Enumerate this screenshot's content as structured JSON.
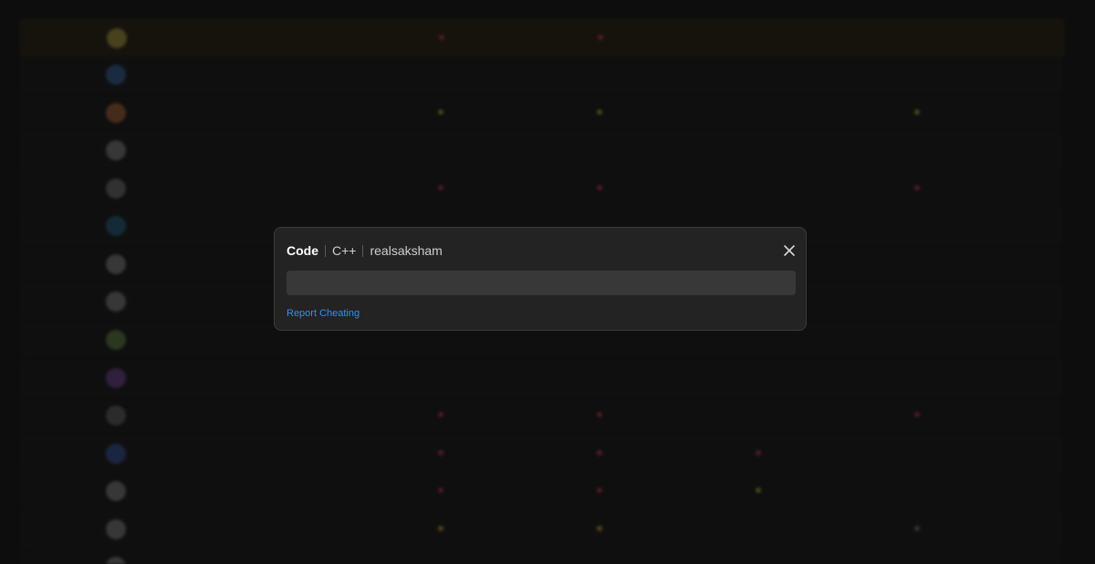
{
  "modal": {
    "title": "Code",
    "language": "C++",
    "username": "realsaksham",
    "code": "",
    "report_link": "Report Cheating"
  },
  "colors": {
    "accent_link": "#3b8ee6",
    "modal_bg": "#232323",
    "highlight_row": "#2e2614",
    "down_indicator": "#d23a52",
    "up_indicator": "#c8b23a"
  },
  "icons": {
    "close": "close-icon"
  }
}
